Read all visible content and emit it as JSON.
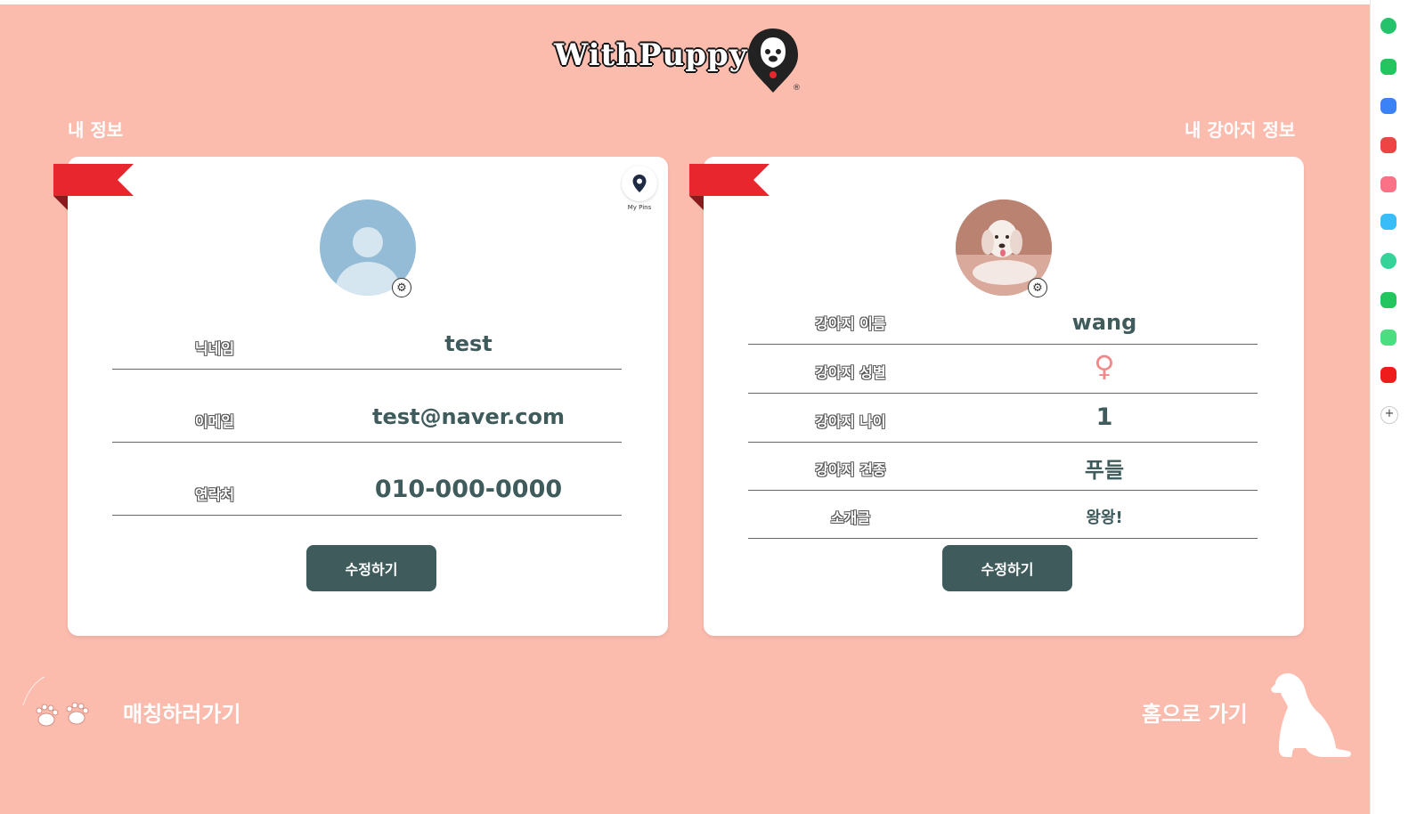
{
  "logo": {
    "text": "WithPuppy",
    "reg": "®"
  },
  "sections": {
    "my_info_title": "내 정보",
    "dog_info_title": "내 강아지 정보"
  },
  "my_info": {
    "pins_label": "My Pins",
    "rows": [
      {
        "label": "닉네임",
        "value": "test"
      },
      {
        "label": "이메일",
        "value": "test@naver.com"
      },
      {
        "label": "연락처",
        "value": "010-000-0000"
      }
    ],
    "edit_button": "수정하기"
  },
  "dog_info": {
    "rows": [
      {
        "label": "강아지 이름",
        "value": "wang"
      },
      {
        "label": "강아지 성별",
        "value": "♀"
      },
      {
        "label": "강아지 나이",
        "value": "1"
      },
      {
        "label": "강아지 견종",
        "value": "푸들"
      },
      {
        "label": "소개글",
        "value": "왕왕!"
      }
    ],
    "edit_button": "수정하기"
  },
  "bottom": {
    "matching_link": "매칭하러가기",
    "home_link": "홈으로 가기"
  },
  "colors": {
    "background": "#fbbcae",
    "card": "#ffffff",
    "button": "#3f5b5b",
    "value_text": "#3f5b5b",
    "ribbon": "#e8262e",
    "female_symbol": "#f08a8a"
  },
  "icons": {
    "pins": "map-pin-icon",
    "avatar_settings": "gear-icon",
    "female": "female-icon",
    "matching": "paw-prints-icon",
    "home": "dog-silhouette-icon"
  }
}
